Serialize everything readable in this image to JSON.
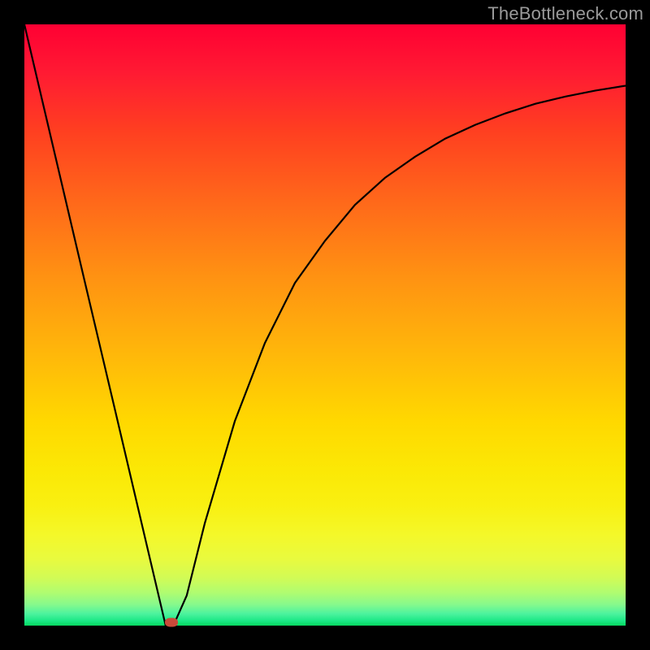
{
  "watermark": "TheBottleneck.com",
  "colors": {
    "frame": "#000000",
    "curve": "#000000",
    "marker": "#c94a3a"
  },
  "chart_data": {
    "type": "line",
    "title": "",
    "xlabel": "",
    "ylabel": "",
    "xlim": [
      0,
      100
    ],
    "ylim": [
      0,
      100
    ],
    "grid": false,
    "series": [
      {
        "name": "curve",
        "x": [
          0,
          5,
          10,
          15,
          20,
          23.5,
          25,
          27,
          30,
          35,
          40,
          45,
          50,
          55,
          60,
          65,
          70,
          75,
          80,
          85,
          90,
          95,
          100
        ],
        "y": [
          100,
          78.7,
          57.4,
          36.2,
          14.9,
          0,
          0.5,
          5,
          17,
          34,
          47,
          57,
          64,
          70,
          74.5,
          78,
          81,
          83.3,
          85.2,
          86.8,
          88,
          89,
          89.8
        ]
      }
    ],
    "annotations": [
      {
        "name": "marker",
        "x": 24.5,
        "y": 0.5
      }
    ],
    "background_gradient": {
      "direction": "top-to-bottom",
      "stops": [
        {
          "pos": 0,
          "color": "#ff0033"
        },
        {
          "pos": 0.55,
          "color": "#ffd800"
        },
        {
          "pos": 0.82,
          "color": "#f7f420"
        },
        {
          "pos": 1.0,
          "color": "#07d860"
        }
      ]
    }
  }
}
